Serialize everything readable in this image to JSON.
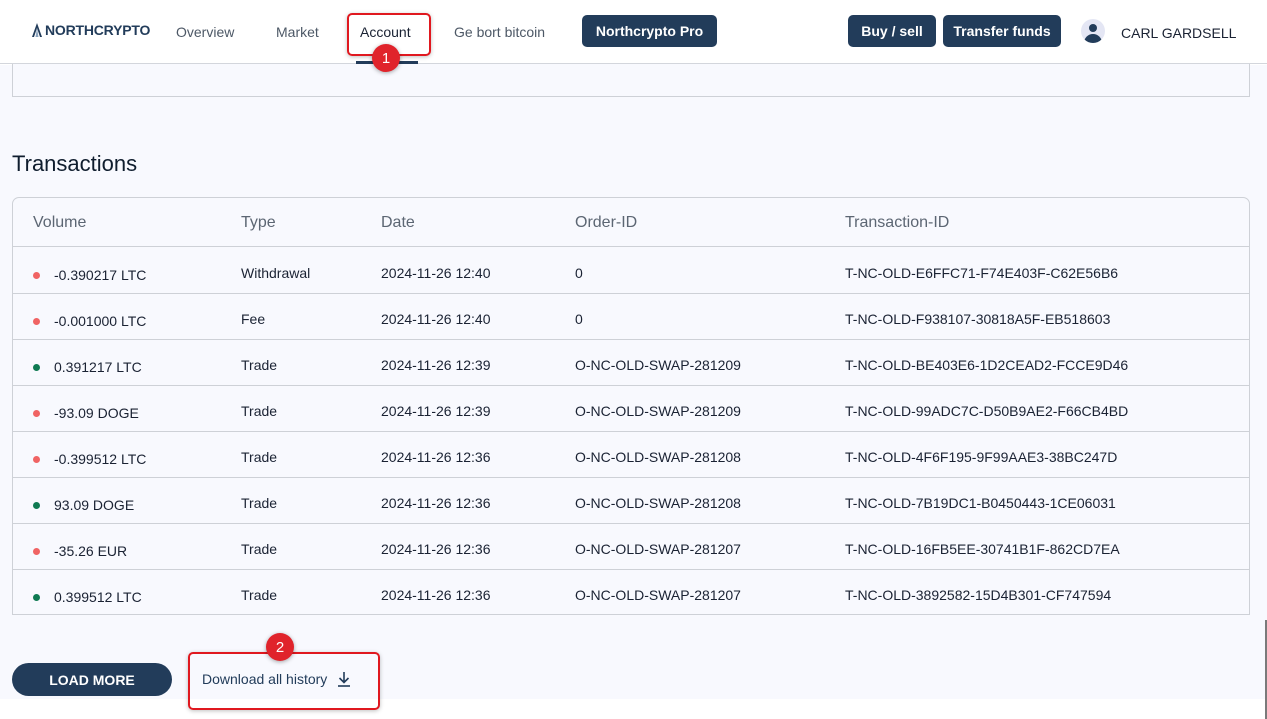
{
  "header": {
    "logo_text": "NORTHCRYPTO",
    "nav": [
      {
        "label": "Overview",
        "active": false
      },
      {
        "label": "Market",
        "active": false
      },
      {
        "label": "Account",
        "active": true
      },
      {
        "label": "Ge bort bitcoin",
        "active": false
      }
    ],
    "pro_button": "Northcrypto Pro",
    "buy_sell_button": "Buy / sell",
    "transfer_button": "Transfer funds",
    "user_name": "CARL GARDSELL"
  },
  "transactions": {
    "title": "Transactions",
    "columns": [
      "Volume",
      "Type",
      "Date",
      "Order-ID",
      "Transaction-ID"
    ],
    "rows": [
      {
        "volume": "-0.390217 LTC",
        "direction": "negative",
        "type": "Withdrawal",
        "date": "2024-11-26 12:40",
        "order_id": "0",
        "transaction_id": "T-NC-OLD-E6FFC71-F74E403F-C62E56B6"
      },
      {
        "volume": "-0.001000 LTC",
        "direction": "negative",
        "type": "Fee",
        "date": "2024-11-26 12:40",
        "order_id": "0",
        "transaction_id": "T-NC-OLD-F938107-30818A5F-EB518603"
      },
      {
        "volume": "0.391217 LTC",
        "direction": "positive",
        "type": "Trade",
        "date": "2024-11-26 12:39",
        "order_id": "O-NC-OLD-SWAP-281209",
        "transaction_id": "T-NC-OLD-BE403E6-1D2CEAD2-FCCE9D46"
      },
      {
        "volume": "-93.09 DOGE",
        "direction": "negative",
        "type": "Trade",
        "date": "2024-11-26 12:39",
        "order_id": "O-NC-OLD-SWAP-281209",
        "transaction_id": "T-NC-OLD-99ADC7C-D50B9AE2-F66CB4BD"
      },
      {
        "volume": "-0.399512 LTC",
        "direction": "negative",
        "type": "Trade",
        "date": "2024-11-26 12:36",
        "order_id": "O-NC-OLD-SWAP-281208",
        "transaction_id": "T-NC-OLD-4F6F195-9F99AAE3-38BC247D"
      },
      {
        "volume": "93.09 DOGE",
        "direction": "positive",
        "type": "Trade",
        "date": "2024-11-26 12:36",
        "order_id": "O-NC-OLD-SWAP-281208",
        "transaction_id": "T-NC-OLD-7B19DC1-B0450443-1CE06031"
      },
      {
        "volume": "-35.26 EUR",
        "direction": "negative",
        "type": "Trade",
        "date": "2024-11-26 12:36",
        "order_id": "O-NC-OLD-SWAP-281207",
        "transaction_id": "T-NC-OLD-16FB5EE-30741B1F-862CD7EA"
      },
      {
        "volume": "0.399512 LTC",
        "direction": "positive",
        "type": "Trade",
        "date": "2024-11-26 12:36",
        "order_id": "O-NC-OLD-SWAP-281207",
        "transaction_id": "T-NC-OLD-3892582-15D4B301-CF747594"
      }
    ],
    "load_more_button": "LOAD MORE",
    "download_link": "Download all history"
  },
  "annotations": [
    {
      "number": "1",
      "target": "Account"
    },
    {
      "number": "2",
      "target": "Download all history"
    }
  ],
  "colors": {
    "brand": "#223c5a",
    "positive": "#0f7a52",
    "negative": "#f06464",
    "annotation": "#e0181f"
  }
}
